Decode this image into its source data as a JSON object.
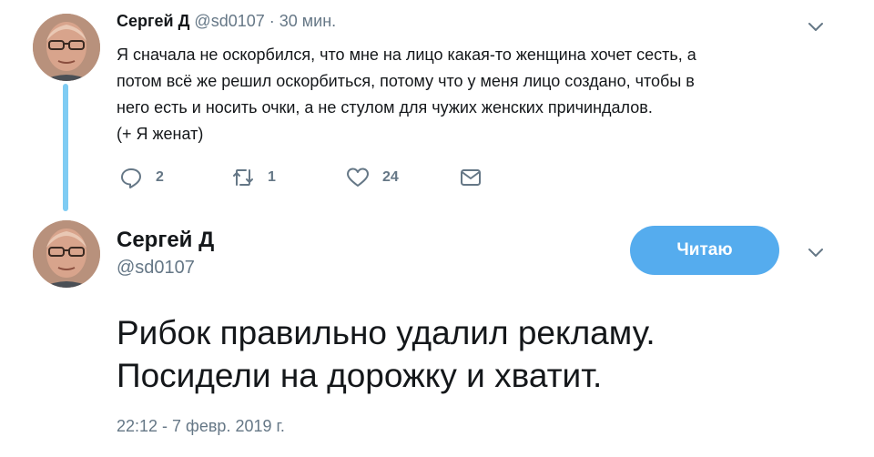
{
  "tweet_reply": {
    "author_name": "Сергей Д",
    "author_handle": "@sd0107",
    "separator": "·",
    "time": "30 мин.",
    "lines": [
      "Я сначала не оскорбился, что мне на лицо какая-то женщина хочет сесть, а",
      "потом всё же решил оскорбиться, потому что у меня лицо создано, чтобы в",
      "него есть и носить очки, а не стулом для чужих женских причиндалов.",
      "(+ Я женат)"
    ],
    "actions": {
      "reply_icon": "reply-icon",
      "reply_count": "2",
      "retweet_icon": "retweet-icon",
      "retweet_count": "1",
      "like_icon": "heart-icon",
      "like_count": "24",
      "dm_icon": "envelope-icon"
    },
    "menu_icon": "chevron-down-icon"
  },
  "tweet_main": {
    "author_name": "Сергей Д",
    "author_handle": "@sd0107",
    "follow_label": "Читаю",
    "lines": [
      "Рибок правильно удалил рекламу.",
      "Посидели на дорожку и хватит."
    ],
    "date": "22:12 - 7 февр. 2019 г.",
    "menu_icon": "chevron-down-icon"
  },
  "colors": {
    "accent": "#55acee",
    "thread_line": "#7fccf3",
    "muted_text": "#657786",
    "primary_text": "#14171a"
  }
}
